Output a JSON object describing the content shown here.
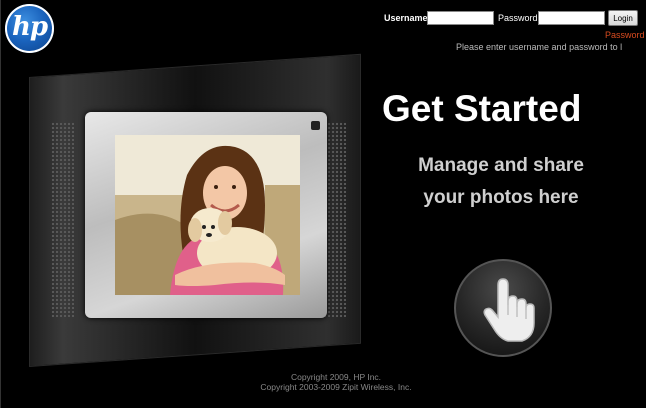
{
  "logo": {
    "text": "hp"
  },
  "login": {
    "username_label": "Username",
    "password_label": "Password",
    "username_value": "",
    "password_value": "",
    "login_button": "Login",
    "password_link": "Password",
    "hint": "Please enter username and password to l"
  },
  "main": {
    "title": "Get Started",
    "subtitle_line1": "Manage and share",
    "subtitle_line2": "your photos here"
  },
  "footer": {
    "copyright_line1": "Copyright 2009, HP Inc.",
    "copyright_line2": "Copyright 2003-2009 Zipit Wireless, Inc."
  },
  "colors": {
    "background": "#000000",
    "link": "#d94b1f",
    "logo_blue": "#1a63bd"
  },
  "icons": {
    "start_button": "pointing-hand-icon"
  }
}
